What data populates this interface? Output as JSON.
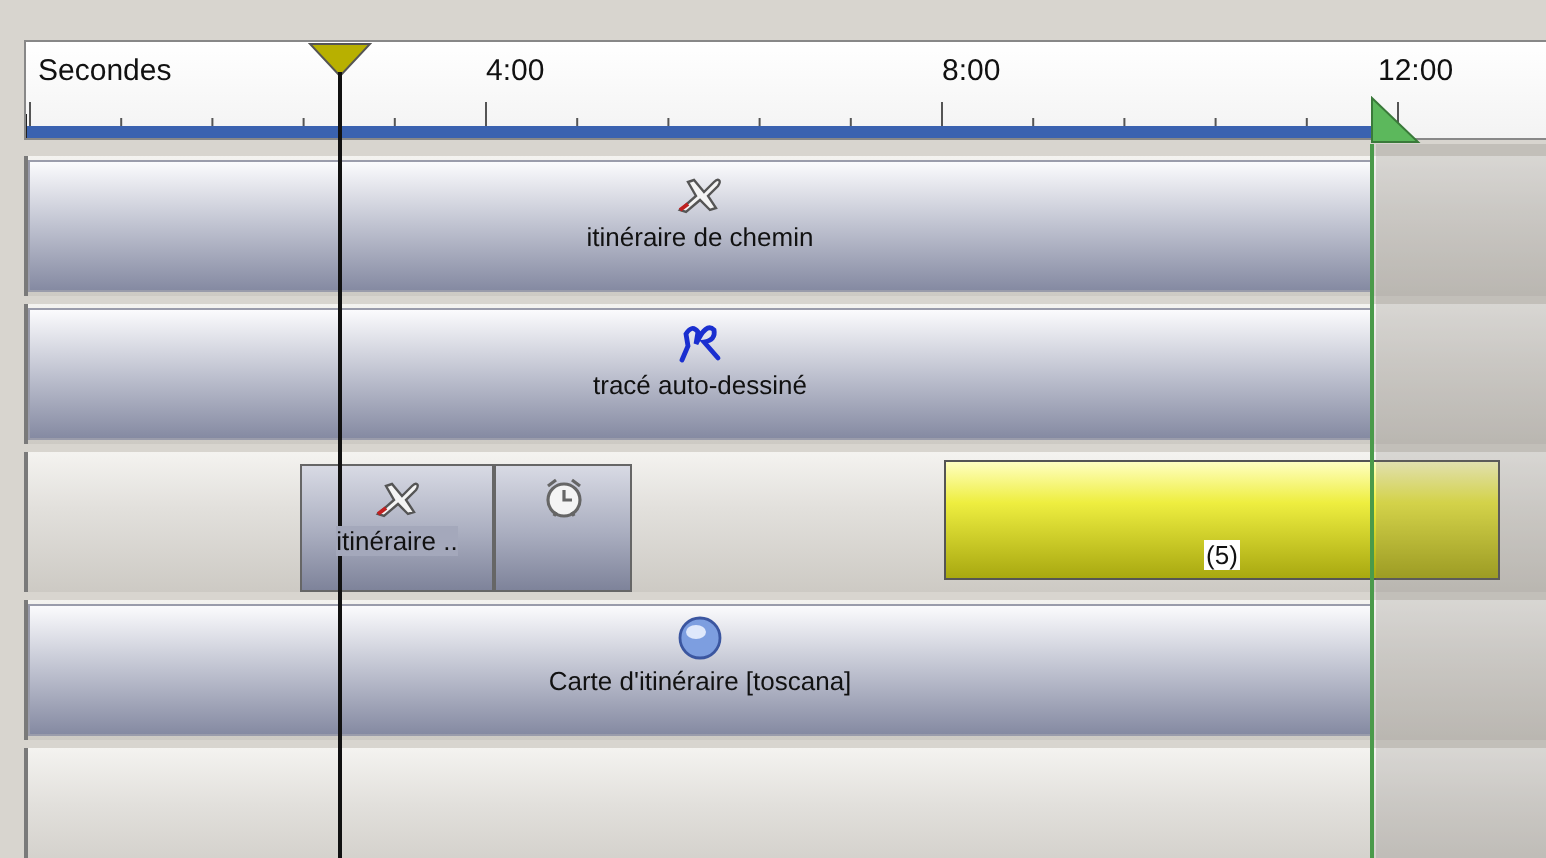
{
  "ruler": {
    "unit_label": "Secondes",
    "ticks": [
      "4:00",
      "8:00",
      "12:00"
    ]
  },
  "tracks": [
    {
      "clips": [
        {
          "kind": "bar",
          "label": "itinéraire de chemin"
        }
      ]
    },
    {
      "clips": [
        {
          "kind": "bar",
          "label": "tracé auto-dessiné"
        }
      ]
    },
    {
      "clips": [
        {
          "kind": "small",
          "label": "itinéraire .."
        },
        {
          "kind": "small"
        },
        {
          "kind": "highlight",
          "label": "(5)"
        }
      ]
    },
    {
      "clips": [
        {
          "kind": "bar",
          "label": "Carte d'itinéraire [toscana]"
        }
      ]
    }
  ]
}
